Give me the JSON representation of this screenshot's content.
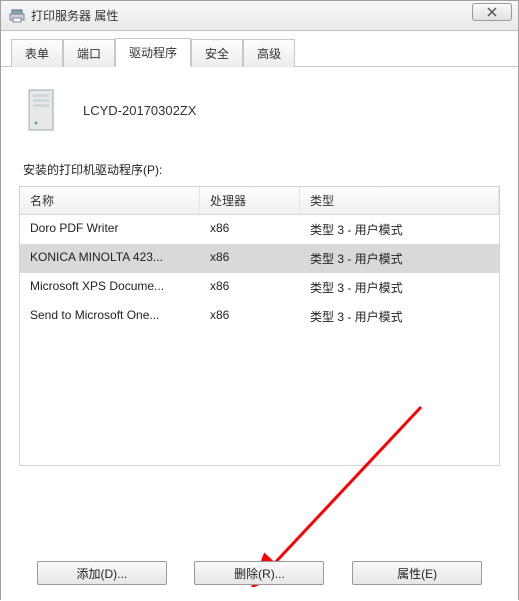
{
  "window": {
    "title": "打印服务器 属性"
  },
  "tabs": {
    "items": [
      {
        "label": "表单"
      },
      {
        "label": "端口"
      },
      {
        "label": "驱动程序"
      },
      {
        "label": "安全"
      },
      {
        "label": "高级"
      }
    ],
    "active_index": 2
  },
  "server": {
    "name": "LCYD-20170302ZX"
  },
  "drivers": {
    "section_label": "安装的打印机驱动程序(P):",
    "columns": {
      "name": "名称",
      "processor": "处理器",
      "type": "类型"
    },
    "rows": [
      {
        "name": "Doro PDF Writer",
        "processor": "x86",
        "type": "类型 3 - 用户模式"
      },
      {
        "name": "KONICA MINOLTA 423...",
        "processor": "x86",
        "type": "类型 3 - 用户模式"
      },
      {
        "name": "Microsoft XPS Docume...",
        "processor": "x86",
        "type": "类型 3 - 用户模式"
      },
      {
        "name": "Send to Microsoft One...",
        "processor": "x86",
        "type": "类型 3 - 用户模式"
      }
    ],
    "selected_index": 1
  },
  "buttons": {
    "add": "添加(D)...",
    "remove": "删除(R)...",
    "properties": "属性(E)"
  }
}
